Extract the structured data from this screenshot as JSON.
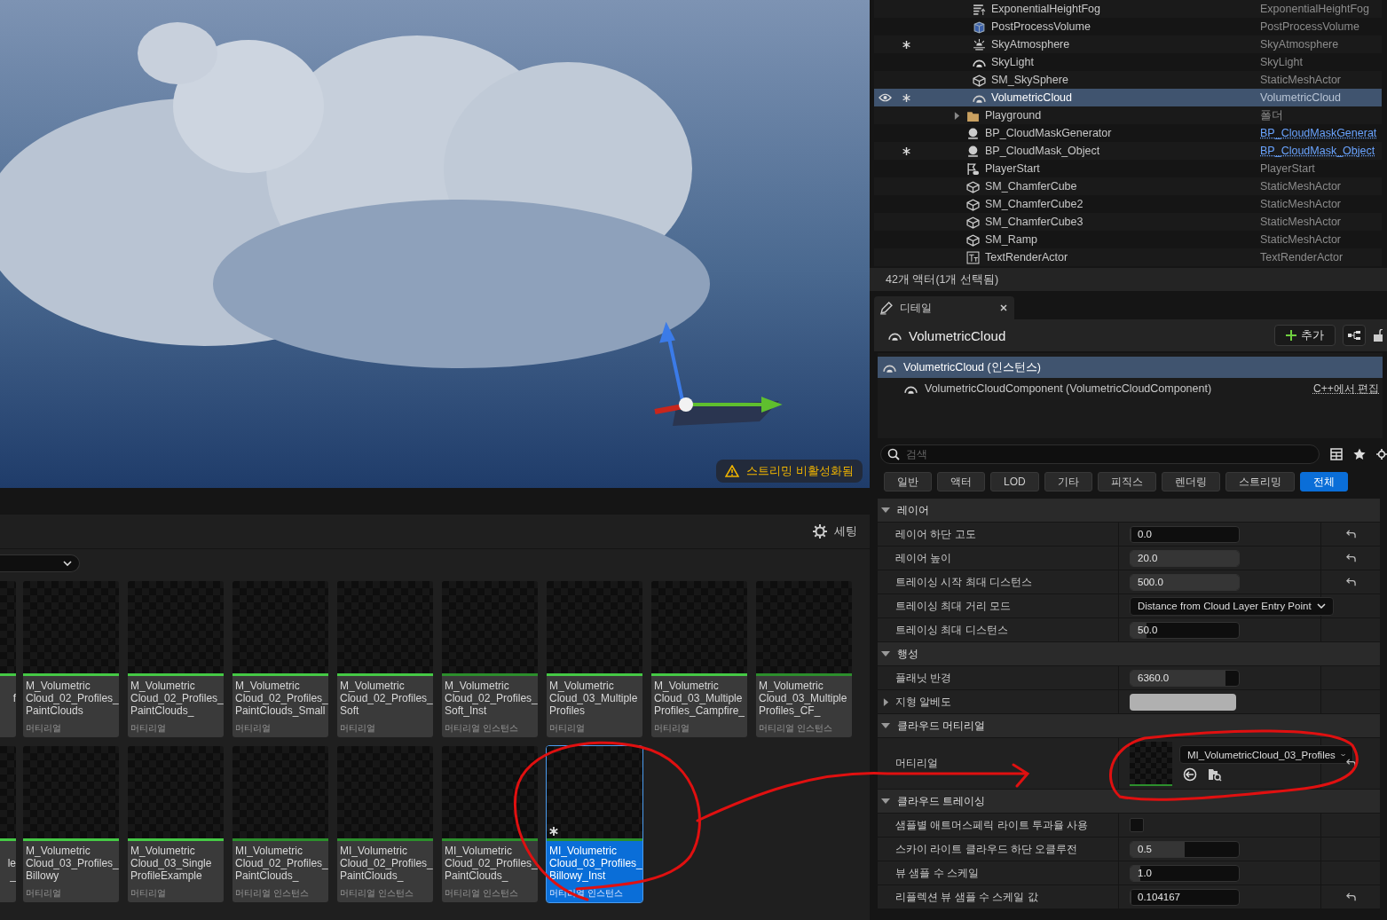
{
  "viewport": {
    "kind": "picture",
    "warning": "스트리밍 비활성화됨"
  },
  "content_browser": {
    "settings_label": "세팅",
    "tile_rows": [
      [
        {
          "kind": "partial",
          "lines": [
            "f"
          ]
        },
        {
          "kind": "material",
          "lines": [
            "M_Volumetric",
            "Cloud_02_Profiles_",
            "PaintClouds"
          ],
          "type_label": "머티리얼",
          "selected": false,
          "modified": false
        },
        {
          "kind": "material",
          "lines": [
            "M_Volumetric",
            "Cloud_02_Profiles_",
            "PaintClouds_"
          ],
          "type_label": "머티리얼",
          "selected": false,
          "modified": false
        },
        {
          "kind": "material",
          "lines": [
            "M_Volumetric",
            "Cloud_02_Profiles_",
            "PaintClouds_Small"
          ],
          "type_label": "머티리얼",
          "selected": false,
          "modified": false
        },
        {
          "kind": "material",
          "lines": [
            "M_Volumetric",
            "Cloud_02_Profiles_",
            "Soft"
          ],
          "type_label": "머티리얼",
          "selected": false,
          "modified": false
        },
        {
          "kind": "instance",
          "lines": [
            "M_Volumetric",
            "Cloud_02_Profiles_",
            "Soft_Inst"
          ],
          "type_label": "머티리얼 인스턴스",
          "selected": false,
          "modified": false
        },
        {
          "kind": "material",
          "lines": [
            "M_Volumetric",
            "Cloud_03_Multiple",
            "Profiles"
          ],
          "type_label": "머티리얼",
          "selected": false,
          "modified": false
        },
        {
          "kind": "material",
          "lines": [
            "M_Volumetric",
            "Cloud_03_Multiple",
            "Profiles_Campfire_"
          ],
          "type_label": "머티리얼",
          "selected": false,
          "modified": false
        },
        {
          "kind": "instance",
          "lines": [
            "M_Volumetric",
            "Cloud_03_Multiple",
            "Profiles_CF_"
          ],
          "type_label": "머티리얼 인스턴스",
          "selected": false,
          "modified": false
        }
      ],
      [
        {
          "kind": "partial",
          "lines": [
            "le",
            "_"
          ]
        },
        {
          "kind": "material",
          "lines": [
            "M_Volumetric",
            "Cloud_03_Profiles_",
            "Billowy"
          ],
          "type_label": "머티리얼",
          "selected": false,
          "modified": false
        },
        {
          "kind": "material",
          "lines": [
            "M_Volumetric",
            "Cloud_03_Single",
            "ProfileExample"
          ],
          "type_label": "머티리얼",
          "selected": false,
          "modified": false
        },
        {
          "kind": "instance",
          "lines": [
            "MI_Volumetric",
            "Cloud_02_Profiles_",
            "PaintClouds_"
          ],
          "type_label": "머티리얼 인스턴스",
          "selected": false,
          "modified": false
        },
        {
          "kind": "instance",
          "lines": [
            "MI_Volumetric",
            "Cloud_02_Profiles_",
            "PaintClouds_"
          ],
          "type_label": "머티리얼 인스턴스",
          "selected": false,
          "modified": false
        },
        {
          "kind": "instance",
          "lines": [
            "MI_Volumetric",
            "Cloud_02_Profiles_",
            "PaintClouds_"
          ],
          "type_label": "머티리얼 인스턴스",
          "selected": false,
          "modified": false
        },
        {
          "kind": "instance",
          "lines": [
            "MI_Volumetric",
            "Cloud_03_Profiles_",
            "Billowy_Inst"
          ],
          "type_label": "머티리얼 인스턴스",
          "selected": true,
          "modified": true
        }
      ]
    ]
  },
  "outliner": {
    "nested_items": [
      {
        "name": "ExponentialHeightFog",
        "type": "ExponentialHeightFog",
        "kind": "fog",
        "modified": false,
        "selected": false,
        "type_link": false
      },
      {
        "name": "PostProcessVolume",
        "type": "PostProcessVolume",
        "kind": "volume",
        "modified": false,
        "selected": false,
        "type_link": false
      },
      {
        "name": "SkyAtmosphere",
        "type": "SkyAtmosphere",
        "kind": "sun",
        "modified": true,
        "selected": false,
        "type_link": false
      },
      {
        "name": "SkyLight",
        "type": "SkyLight",
        "kind": "dome",
        "modified": false,
        "selected": false,
        "type_link": false
      },
      {
        "name": "SM_SkySphere",
        "type": "StaticMeshActor",
        "kind": "mesh",
        "modified": false,
        "selected": false,
        "type_link": false
      },
      {
        "name": "VolumetricCloud",
        "type": "VolumetricCloud",
        "kind": "cloud",
        "modified": true,
        "selected": true,
        "type_link": false
      }
    ],
    "items": [
      {
        "name": "Playground",
        "type": "폴더",
        "kind": "folder",
        "expanded": false,
        "modified": false,
        "selected": false,
        "type_link": false
      },
      {
        "name": "BP_CloudMaskGenerator",
        "type": "BP_CloudMaskGenerat",
        "kind": "blueprint",
        "modified": false,
        "selected": false,
        "type_link": true
      },
      {
        "name": "BP_CloudMask_Object",
        "type": "BP_CloudMask_Object",
        "kind": "blueprint",
        "modified": true,
        "selected": false,
        "type_link": true
      },
      {
        "name": "PlayerStart",
        "type": "PlayerStart",
        "kind": "flag",
        "modified": false,
        "selected": false,
        "type_link": false
      },
      {
        "name": "SM_ChamferCube",
        "type": "StaticMeshActor",
        "kind": "mesh",
        "modified": false,
        "selected": false,
        "type_link": false
      },
      {
        "name": "SM_ChamferCube2",
        "type": "StaticMeshActor",
        "kind": "mesh",
        "modified": false,
        "selected": false,
        "type_link": false
      },
      {
        "name": "SM_ChamferCube3",
        "type": "StaticMeshActor",
        "kind": "mesh",
        "modified": false,
        "selected": false,
        "type_link": false
      },
      {
        "name": "SM_Ramp",
        "type": "StaticMeshActor",
        "kind": "mesh",
        "modified": false,
        "selected": false,
        "type_link": false
      },
      {
        "name": "TextRenderActor",
        "type": "TextRenderActor",
        "kind": "text",
        "modified": false,
        "selected": false,
        "type_link": false
      }
    ],
    "status": "42개 액터(1개 선택됨)"
  },
  "details": {
    "tab": "디테일",
    "actor_name": "VolumetricCloud",
    "add_button": "추가",
    "components": [
      {
        "label": "VolumetricCloud (인스턴스)",
        "selected": true
      },
      {
        "label": "VolumetricCloudComponent (VolumetricCloudComponent)",
        "selected": false,
        "link": "C++에서 편집"
      }
    ],
    "search": {
      "placeholder": "검색"
    },
    "filters": [
      {
        "label": "일반",
        "selected": false
      },
      {
        "label": "액터",
        "selected": false
      },
      {
        "label": "LOD",
        "selected": false
      },
      {
        "label": "기타",
        "selected": false
      },
      {
        "label": "피직스",
        "selected": false
      },
      {
        "label": "렌더링",
        "selected": false
      },
      {
        "label": "스트리밍",
        "selected": false
      },
      {
        "label": "전체",
        "selected": true
      }
    ],
    "sections": [
      {
        "title": "레이어",
        "expanded": true,
        "rows": [
          {
            "kind": "number",
            "label": "레이어 하단 고도",
            "value": "0.0",
            "level": 0,
            "resettable": true
          },
          {
            "kind": "number",
            "label": "레이어 높이",
            "value": "20.0",
            "level": 1,
            "resettable": true
          },
          {
            "kind": "number",
            "label": "트레이싱 시작 최대 디스턴스",
            "value": "500.0",
            "level": 1,
            "resettable": true
          },
          {
            "kind": "dropdown",
            "label": "트레이싱 최대 거리 모드",
            "value": "Distance from Cloud Layer Entry Point",
            "resettable": false
          },
          {
            "kind": "number",
            "label": "트레이싱 최대 디스턴스",
            "value": "50.0",
            "level": 0.15,
            "resettable": false
          }
        ]
      },
      {
        "title": "행성",
        "expanded": true,
        "rows": [
          {
            "kind": "number",
            "label": "플래닛 반경",
            "value": "6360.0",
            "level": 0.88,
            "resettable": false
          },
          {
            "kind": "color",
            "label": "지형 알베도",
            "expanded": false,
            "color": "#b0b0b0",
            "resettable": false
          }
        ]
      },
      {
        "title": "클라우드 머티리얼",
        "expanded": true,
        "rows": [
          {
            "kind": "asset",
            "label": "머티리얼",
            "value": "MI_VolumetricCloud_03_Profiles",
            "resettable": true
          }
        ]
      },
      {
        "title": "클라우드 트레이싱",
        "expanded": true,
        "rows": [
          {
            "kind": "checkbox",
            "label": "샘플별 애트머스페릭 라이트 투과율 사용",
            "checked": false,
            "resettable": false
          },
          {
            "kind": "number",
            "label": "스카이 라이트 클라우드 하단 오클루전",
            "value": "0.5",
            "level": 0.5,
            "resettable": false
          },
          {
            "kind": "number",
            "label": "뷰 샘플 수 스케일",
            "value": "1.0",
            "level": 0.09,
            "resettable": false
          },
          {
            "kind": "number",
            "label": "리플렉션 뷰 샘플 수 스케일 값",
            "value": "0.104167",
            "level": 0,
            "resettable": true
          }
        ]
      }
    ]
  }
}
